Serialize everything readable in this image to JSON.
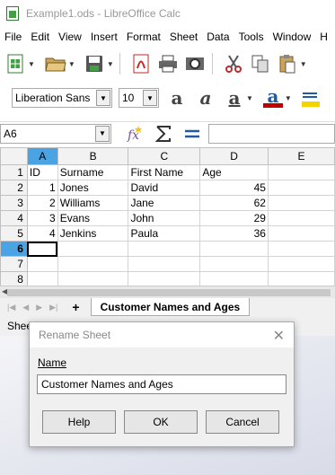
{
  "window": {
    "title": "Example1.ods - LibreOffice Calc"
  },
  "menu": [
    "File",
    "Edit",
    "View",
    "Insert",
    "Format",
    "Sheet",
    "Data",
    "Tools",
    "Window",
    "H"
  ],
  "toolbar2": {
    "font_name": "Liberation Sans",
    "font_size": "10"
  },
  "formula_bar": {
    "name_box": "A6",
    "formula": ""
  },
  "columns": [
    "A",
    "B",
    "C",
    "D",
    "E"
  ],
  "rows": [
    {
      "n": "1",
      "a": "ID",
      "b": "Surname",
      "c": "First Name",
      "d": "Age"
    },
    {
      "n": "2",
      "a": "1",
      "b": "Jones",
      "c": "David",
      "d": "45"
    },
    {
      "n": "3",
      "a": "2",
      "b": "Williams",
      "c": "Jane",
      "d": "62"
    },
    {
      "n": "4",
      "a": "3",
      "b": "Evans",
      "c": "John",
      "d": "29"
    },
    {
      "n": "5",
      "a": "4",
      "b": "Jenkins",
      "c": "Paula",
      "d": "36"
    },
    {
      "n": "6",
      "a": "",
      "b": "",
      "c": "",
      "d": ""
    },
    {
      "n": "7",
      "a": "",
      "b": "",
      "c": "",
      "d": ""
    },
    {
      "n": "8",
      "a": "",
      "b": "",
      "c": "",
      "d": ""
    }
  ],
  "tabs": {
    "add": "+",
    "active": "Customer Names and Ages"
  },
  "status": {
    "text": "Shee"
  },
  "dialog": {
    "title": "Rename Sheet",
    "label": "Name",
    "value": "Customer Names and Ages",
    "help": "Help",
    "ok": "OK",
    "cancel": "Cancel"
  }
}
